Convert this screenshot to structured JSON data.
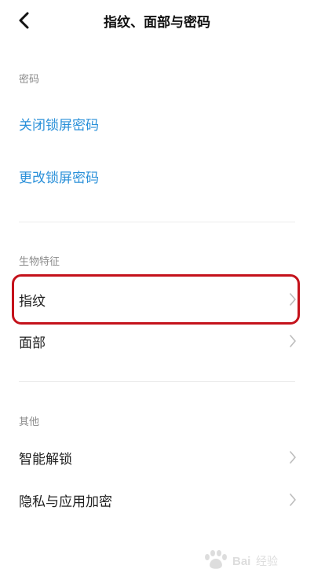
{
  "header": {
    "back_icon": "chevron-left-icon",
    "title": "指纹、面部与密码"
  },
  "sections": {
    "password": {
      "label": "密码",
      "items": [
        {
          "label": "关闭锁屏密码"
        },
        {
          "label": "更改锁屏密码"
        }
      ]
    },
    "biometrics": {
      "label": "生物特征",
      "items": [
        {
          "label": "指纹",
          "highlighted": true
        },
        {
          "label": "面部"
        }
      ]
    },
    "other": {
      "label": "其他",
      "items": [
        {
          "label": "智能解锁"
        },
        {
          "label": "隐私与应用加密"
        }
      ]
    }
  },
  "colors": {
    "link": "#2a90d9",
    "highlight_border": "#c4121b",
    "section_label": "#8a8a8a"
  },
  "watermark": {
    "text": "Baidu 经验"
  }
}
